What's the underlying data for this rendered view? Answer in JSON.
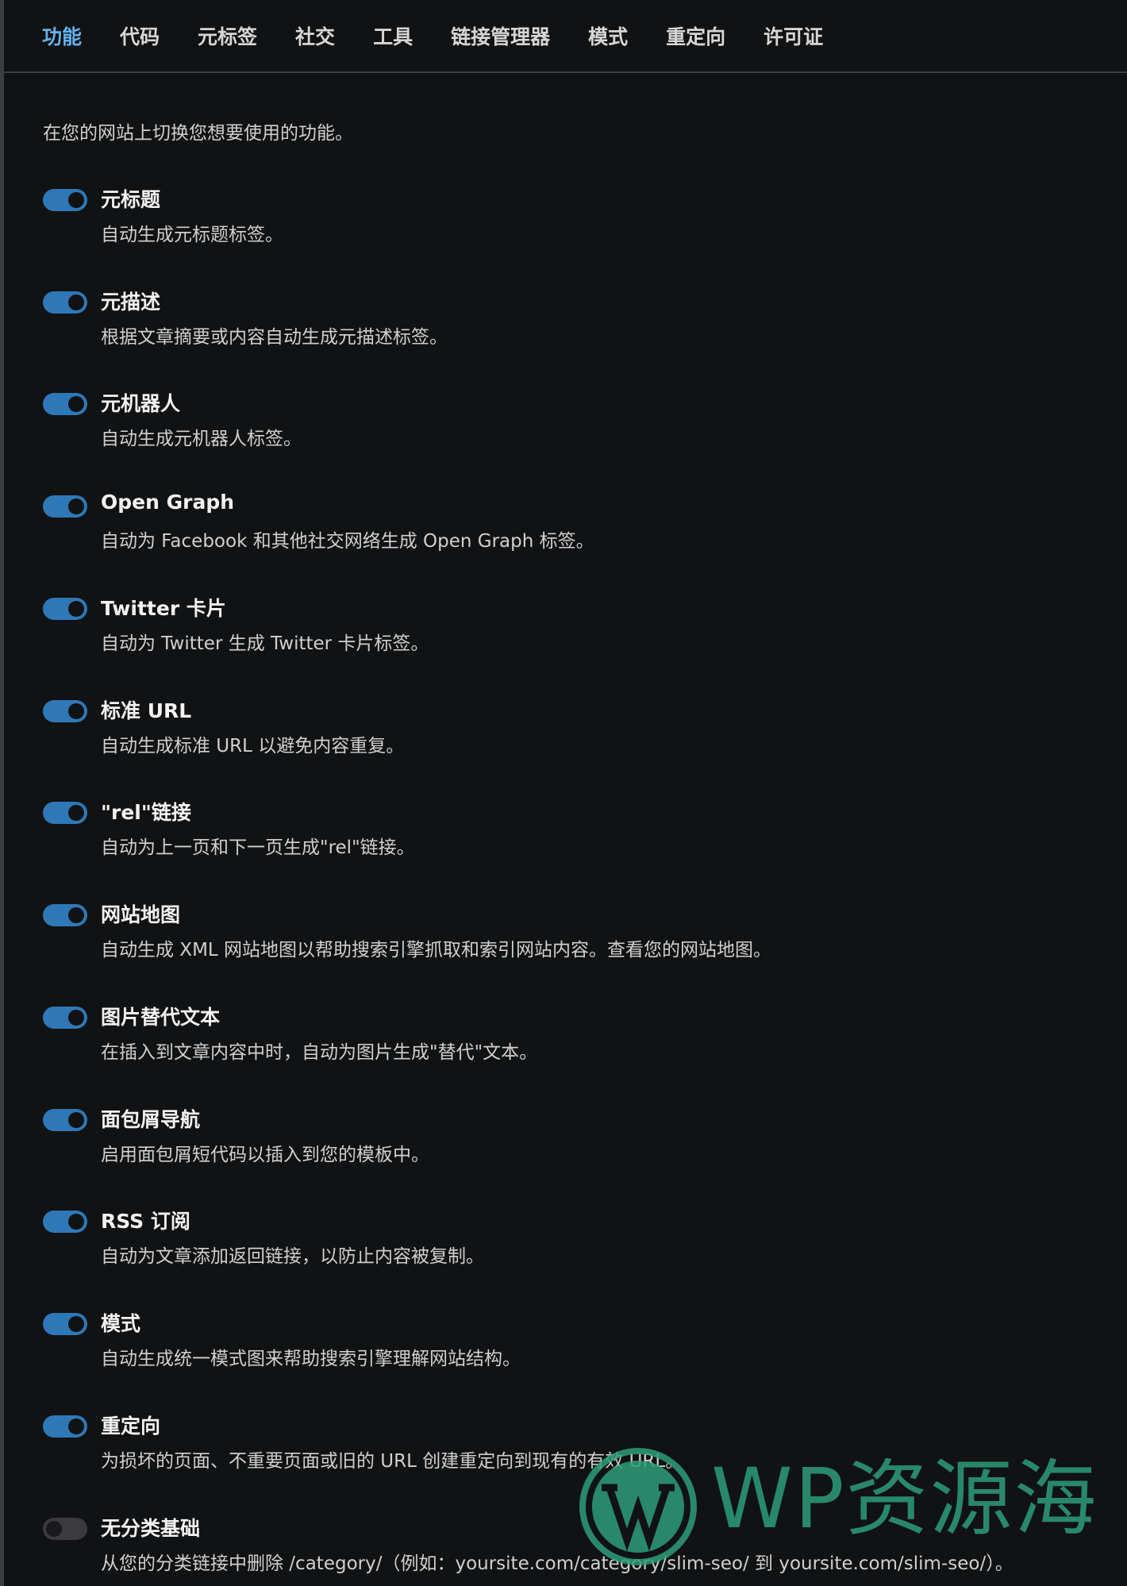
{
  "tabs": [
    {
      "label": "功能",
      "active": true
    },
    {
      "label": "代码",
      "active": false
    },
    {
      "label": "元标签",
      "active": false
    },
    {
      "label": "社交",
      "active": false
    },
    {
      "label": "工具",
      "active": false
    },
    {
      "label": "链接管理器",
      "active": false
    },
    {
      "label": "模式",
      "active": false
    },
    {
      "label": "重定向",
      "active": false
    },
    {
      "label": "许可证",
      "active": false
    }
  ],
  "intro": "在您的网站上切换您想要使用的功能。",
  "features": [
    {
      "title": "元标题",
      "description": "自动生成元标题标签。",
      "enabled": true
    },
    {
      "title": "元描述",
      "description": "根据文章摘要或内容自动生成元描述标签。",
      "enabled": true
    },
    {
      "title": "元机器人",
      "description": "自动生成元机器人标签。",
      "enabled": true
    },
    {
      "title": "Open Graph",
      "description": "自动为 Facebook 和其他社交网络生成 Open Graph 标签。",
      "enabled": true
    },
    {
      "title": "Twitter 卡片",
      "description": "自动为 Twitter 生成 Twitter 卡片标签。",
      "enabled": true
    },
    {
      "title": "标准 URL",
      "description": "自动生成标准 URL 以避免内容重复。",
      "enabled": true
    },
    {
      "title": "\"rel\"链接",
      "description": "自动为上一页和下一页生成\"rel\"链接。",
      "enabled": true
    },
    {
      "title": "网站地图",
      "description": "自动生成 XML 网站地图以帮助搜索引擎抓取和索引网站内容。查看您的网站地图。",
      "enabled": true
    },
    {
      "title": "图片替代文本",
      "description": "在插入到文章内容中时，自动为图片生成\"替代\"文本。",
      "enabled": true
    },
    {
      "title": "面包屑导航",
      "description": "启用面包屑短代码以插入到您的模板中。",
      "enabled": true
    },
    {
      "title": "RSS 订阅",
      "description": "自动为文章添加返回链接，以防止内容被复制。",
      "enabled": true
    },
    {
      "title": "模式",
      "description": "自动生成统一模式图来帮助搜索引擎理解网站结构。",
      "enabled": true
    },
    {
      "title": "重定向",
      "description": "为损坏的页面、不重要页面或旧的 URL 创建重定向到现有的有效 URL。",
      "enabled": true
    },
    {
      "title": "无分类基础",
      "description": "从您的分类链接中删除 /category/（例如：yoursite.com/category/slim-seo/ 到 yoursite.com/slim-seo/）。",
      "enabled": false
    }
  ],
  "watermark": {
    "text": "WP资源海",
    "color": "#2d9d78"
  },
  "colors": {
    "accent": "#63b3ed",
    "toggle_on": "#2e78b7",
    "toggle_off": "#3b3b3d",
    "background": "#101214"
  }
}
